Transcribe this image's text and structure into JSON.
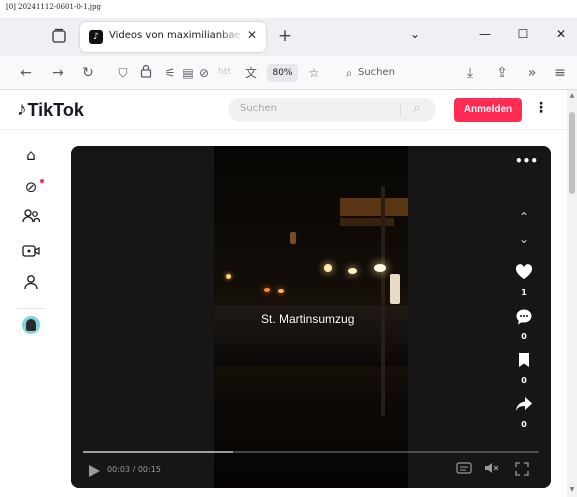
{
  "file_label": "[0] 20241112-0601-0-1.jpg",
  "browser": {
    "tab_title": "Videos von maximilianbaehring",
    "tab_favicon": "tiktok-favicon",
    "zoom": "80%",
    "url_fragment": "htt",
    "search_label": "Suchen"
  },
  "tiktok": {
    "logo_text": "TikTok",
    "search_placeholder": "Suchen",
    "login_label": "Anmelden",
    "brand_color": "#fe2c55",
    "sidebar_icons": [
      "home-icon",
      "explore-icon",
      "following-icon",
      "live-icon",
      "profile-icon"
    ]
  },
  "video": {
    "caption": "St. Martinsumzug",
    "time": "00:03 / 00:15",
    "progress": 0.33,
    "likes": "1",
    "comments": "0",
    "saves": "0",
    "shares": "0"
  }
}
